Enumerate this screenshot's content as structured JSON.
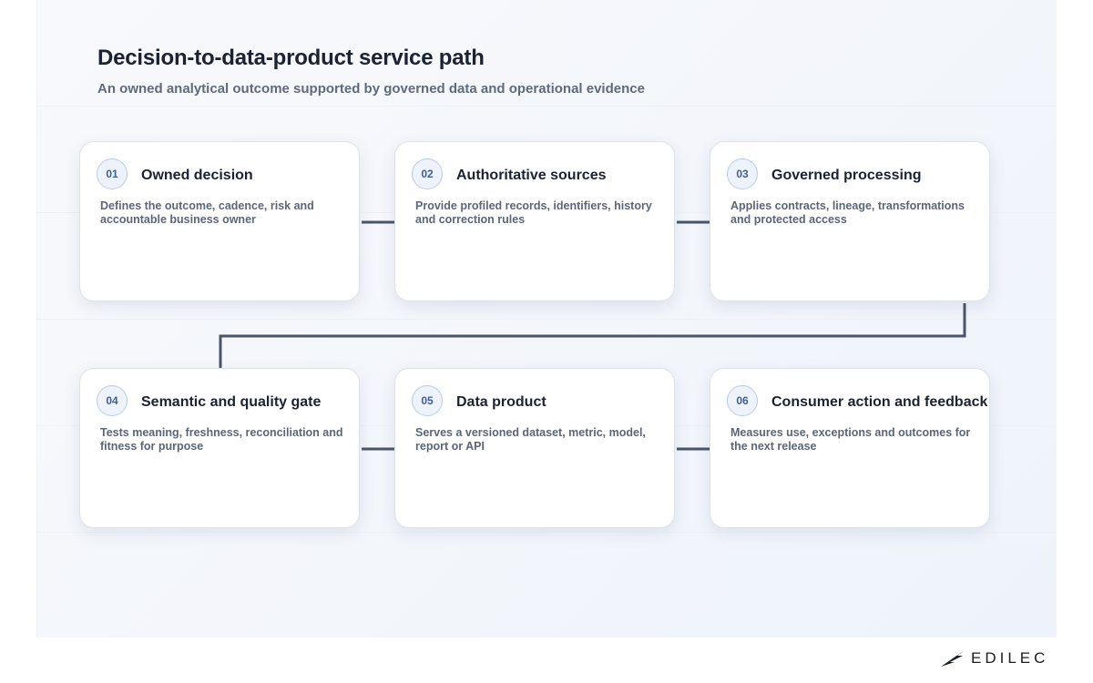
{
  "header": {
    "title": "Decision-to-data-product service path",
    "subtitle": "An owned analytical outcome supported by governed data and operational evidence"
  },
  "steps": [
    {
      "number": "01",
      "title": "Owned decision",
      "description": "Defines the outcome, cadence, risk and accountable business owner"
    },
    {
      "number": "02",
      "title": "Authoritative sources",
      "description": "Provide profiled records, identifiers, history and correction rules"
    },
    {
      "number": "03",
      "title": "Governed processing",
      "description": "Applies contracts, lineage, transformations and protected access"
    },
    {
      "number": "04",
      "title": "Semantic and quality gate",
      "description": "Tests meaning, freshness, reconciliation and fitness for purpose"
    },
    {
      "number": "05",
      "title": "Data product",
      "description": "Serves a versioned dataset, metric, model, report or API"
    },
    {
      "number": "06",
      "title": "Consumer action and feedback",
      "description": "Measures use, exceptions and outcomes for the next release"
    }
  ],
  "brand": {
    "name": "EDILEC",
    "icon": "wing-logo-icon"
  },
  "colors": {
    "connector": "#4a5569",
    "badge_text": "#3e5f93",
    "title_text": "#1a2233"
  }
}
